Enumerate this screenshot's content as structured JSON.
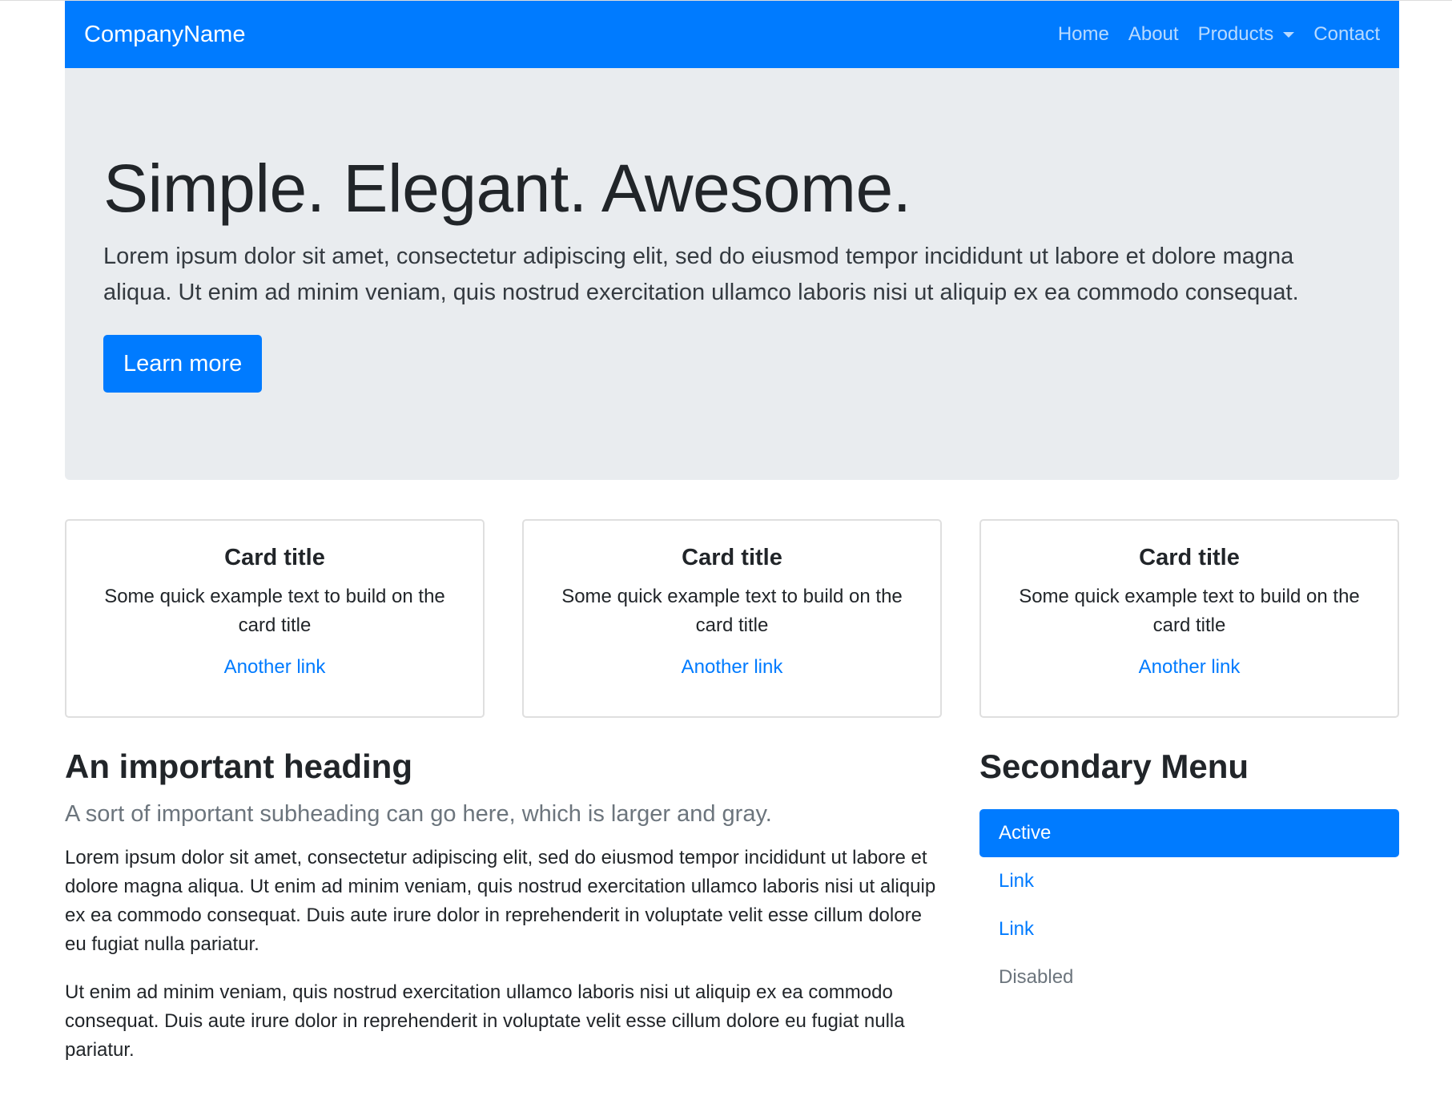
{
  "navbar": {
    "brand": "CompanyName",
    "links": [
      {
        "label": "Home"
      },
      {
        "label": "About"
      },
      {
        "label": "Products"
      },
      {
        "label": "Contact"
      }
    ]
  },
  "hero": {
    "title": "Simple. Elegant. Awesome.",
    "lead": "Lorem ipsum dolor sit amet, consectetur adipiscing elit, sed do eiusmod tempor incididunt ut labore et dolore magna aliqua. Ut enim ad minim veniam, quis nostrud exercitation ullamco laboris nisi ut aliquip ex ea commodo consequat.",
    "button_label": "Learn more"
  },
  "cards": [
    {
      "title": "Card title",
      "text": "Some quick example text to build on the card title",
      "link": "Another link"
    },
    {
      "title": "Card title",
      "text": "Some quick example text to build on the card title",
      "link": "Another link"
    },
    {
      "title": "Card title",
      "text": "Some quick example text to build on the card title",
      "link": "Another link"
    }
  ],
  "main": {
    "heading": "An important heading",
    "subheading": "A sort of important subheading can go here, which is larger and gray.",
    "paragraphs": [
      "Lorem ipsum dolor sit amet, consectetur adipiscing elit, sed do eiusmod tempor incididunt ut labore et dolore magna aliqua. Ut enim ad minim veniam, quis nostrud exercitation ullamco laboris nisi ut aliquip ex ea commodo consequat. Duis aute irure dolor in reprehenderit in voluptate velit esse cillum dolore eu fugiat nulla pariatur.",
      "Ut enim ad minim veniam, quis nostrud exercitation ullamco laboris nisi ut aliquip ex ea commodo consequat. Duis aute irure dolor in reprehenderit in voluptate velit esse cillum dolore eu fugiat nulla pariatur."
    ]
  },
  "sidebar": {
    "heading": "Secondary Menu",
    "items": [
      {
        "label": "Active"
      },
      {
        "label": "Link"
      },
      {
        "label": "Link"
      },
      {
        "label": "Disabled"
      }
    ]
  },
  "colors": {
    "primary": "#007bff",
    "jumbotron_bg": "#e9ecef",
    "muted": "#6c757d",
    "text": "#212529"
  },
  "icons": {
    "products_dropdown": "caret-down-icon"
  }
}
